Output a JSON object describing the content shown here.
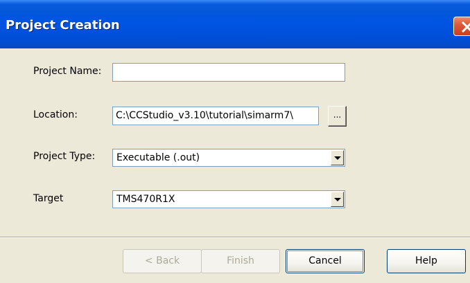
{
  "window": {
    "title": "Project Creation"
  },
  "form": {
    "project_name": {
      "label": "Project Name:",
      "value": ""
    },
    "location": {
      "label": "Location:",
      "value": "C:\\CCStudio_v3.10\\tutorial\\simarm7\\",
      "browse_label": "..."
    },
    "project_type": {
      "label": "Project Type:",
      "value": "Executable (.out)"
    },
    "target": {
      "label": "Target",
      "value": "TMS470R1X"
    }
  },
  "buttons": {
    "back": "< Back",
    "finish": "Finish",
    "cancel": "Cancel",
    "help": "Help"
  },
  "colors": {
    "titlebar": "#0054e3",
    "dialog_bg": "#ece9d8",
    "close_button": "#dd5a3c",
    "field_border": "#7f9db9"
  },
  "icons": {
    "close": "close-icon",
    "dropdown": "chevron-down-icon"
  }
}
